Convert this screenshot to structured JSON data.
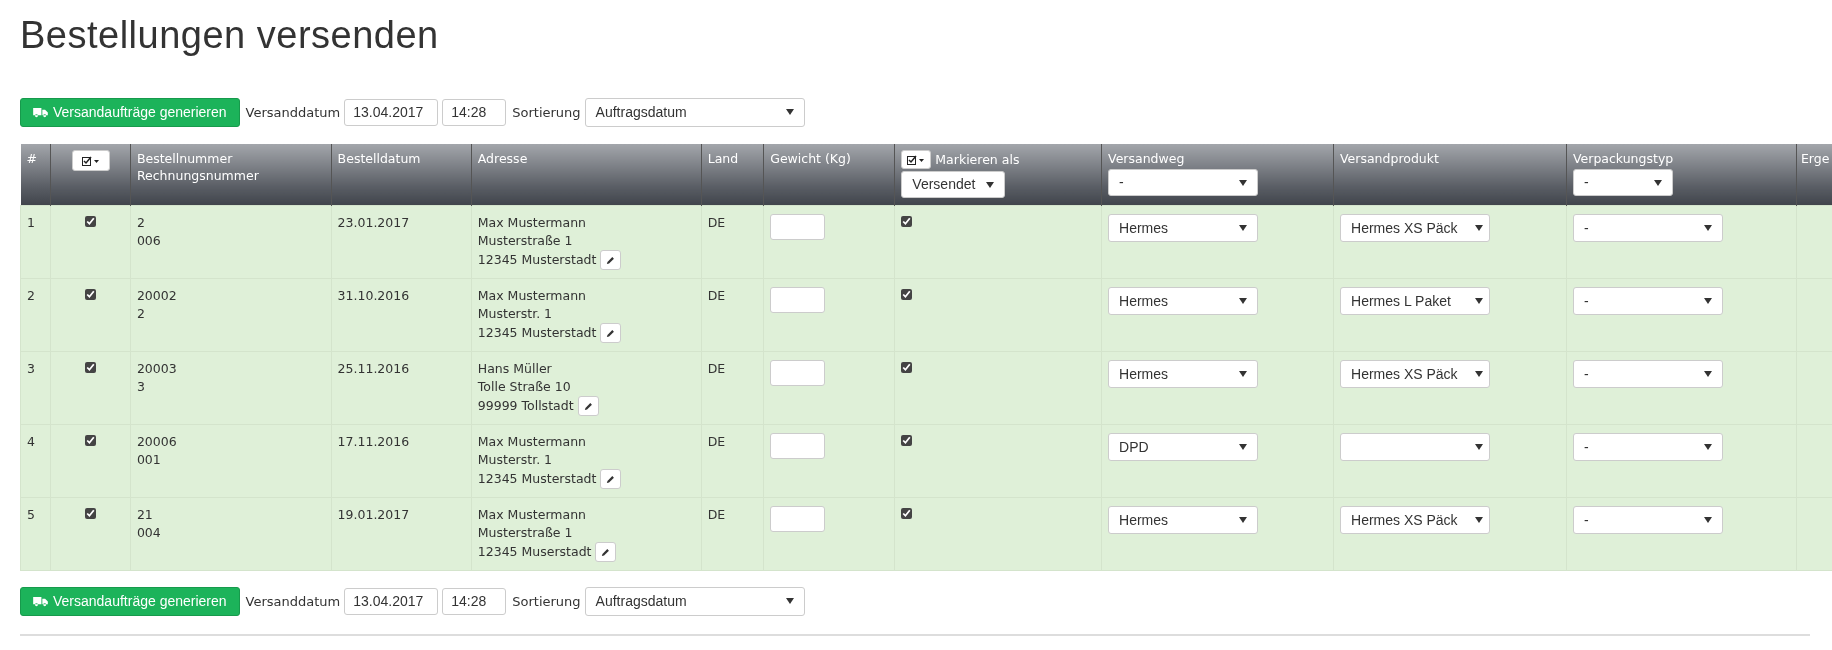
{
  "page_title": "Bestellungen versenden",
  "toolbars": [
    {
      "button": "Versandaufträge generieren",
      "date_label": "Versanddatum",
      "date": "13.04.2017",
      "time": "14:28",
      "sort_label": "Sortierung",
      "sort": "Auftragsdatum"
    },
    {
      "button": "Versandaufträge generieren",
      "date_label": "Versanddatum",
      "date": "13.04.2017",
      "time": "14:28",
      "sort_label": "Sortierung",
      "sort": "Auftragsdatum"
    }
  ],
  "table": {
    "columns": [
      {
        "kind": "text",
        "lines": [
          "#"
        ]
      },
      {
        "kind": "bulk-check"
      },
      {
        "kind": "text",
        "lines": [
          "Bestellnummer",
          "Rechnungsnummer"
        ]
      },
      {
        "kind": "text",
        "lines": [
          "Bestelldatum"
        ]
      },
      {
        "kind": "text",
        "lines": [
          "Adresse"
        ]
      },
      {
        "kind": "text",
        "lines": [
          "Land"
        ]
      },
      {
        "kind": "text",
        "lines": [
          "Gewicht (Kg)"
        ]
      },
      {
        "kind": "mark-as",
        "lines": [
          "Markieren als"
        ],
        "select": "Versendet"
      },
      {
        "kind": "select-filter",
        "lines": [
          "Versandweg"
        ],
        "select": "-"
      },
      {
        "kind": "text",
        "lines": [
          "Versandprodukt"
        ]
      },
      {
        "kind": "select-filter",
        "lines": [
          "Verpackungstyp"
        ],
        "select": "-"
      },
      {
        "kind": "text",
        "lines": [
          "Erge"
        ]
      }
    ],
    "rows": [
      {
        "number": "1",
        "checked": true,
        "order_number": "2",
        "invoice_number": "006",
        "order_date": "23.01.2017",
        "address": [
          "Max Mustermann",
          "Musterstraße 1",
          "12345 Musterstadt"
        ],
        "country": "DE",
        "marked": true,
        "shipping_method": "Hermes",
        "product": "Hermes XS Päck",
        "packaging": "-"
      },
      {
        "number": "2",
        "checked": true,
        "order_number": "20002",
        "invoice_number": "2",
        "order_date": "31.10.2016",
        "address": [
          "Max Mustermann",
          "Musterstr. 1",
          "12345 Musterstadt"
        ],
        "country": "DE",
        "marked": true,
        "shipping_method": "Hermes",
        "product": "Hermes L Paket",
        "packaging": "-"
      },
      {
        "number": "3",
        "checked": true,
        "order_number": "20003",
        "invoice_number": "3",
        "order_date": "25.11.2016",
        "address": [
          "Hans Müller",
          "Tolle Straße 10",
          "99999 Tollstadt"
        ],
        "country": "DE",
        "marked": true,
        "shipping_method": "Hermes",
        "product": "Hermes XS Päck",
        "packaging": "-"
      },
      {
        "number": "4",
        "checked": true,
        "order_number": "20006",
        "invoice_number": "001",
        "order_date": "17.11.2016",
        "address": [
          "Max Mustermann",
          "Musterstr. 1",
          "12345 Musterstadt"
        ],
        "country": "DE",
        "marked": true,
        "shipping_method": "DPD",
        "packaging": "-"
      },
      {
        "number": "5",
        "checked": true,
        "order_number": "21",
        "invoice_number": "004",
        "order_date": "19.01.2017",
        "address": [
          "Max Mustermann",
          "Musterstraße 1",
          "12345 Muserstadt"
        ],
        "country": "DE",
        "marked": true,
        "shipping_method": "Hermes",
        "product": "Hermes XS Päck",
        "packaging": "-"
      }
    ]
  }
}
